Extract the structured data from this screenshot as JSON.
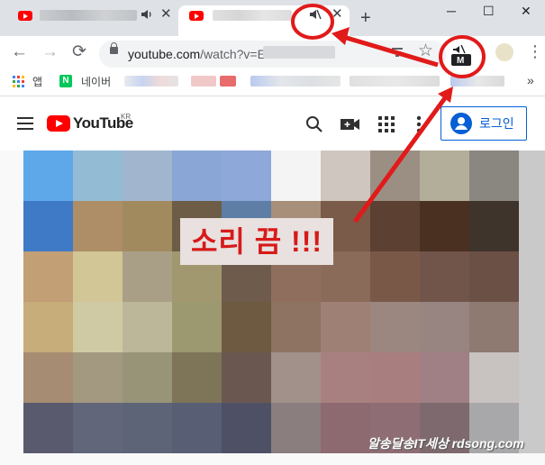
{
  "window": {
    "minimize": "─",
    "maximize": "☐",
    "close": "✕"
  },
  "tabs": [
    {
      "audio_icon": "speaker-icon",
      "close": "✕"
    },
    {
      "audio_icon": "muted-speaker-icon",
      "close": "✕"
    }
  ],
  "new_tab": "+",
  "toolbar": {
    "back": "←",
    "forward": "→",
    "reload": "⟳",
    "url_host": "youtube.com",
    "url_path": "/watch?v=EJi",
    "star": "☆",
    "menu": "⋮",
    "mute_extension_badge": "M"
  },
  "bookmarks": {
    "apps_label": "앱",
    "naver_letter": "N",
    "naver_label": "네이버",
    "more": "»"
  },
  "youtube": {
    "wordmark": "YouTube",
    "region": "KR",
    "login_label": "로그인"
  },
  "annotation": {
    "text": "소리 끔 !!!",
    "color": "#d71a1a"
  },
  "watermark": "알송달송IT세상 rdsong.com",
  "colors": {
    "accent_red": "#ff0000",
    "youtube_blue": "#065fd4",
    "tabstrip": "#dee1e6",
    "mosaic": [
      "#5ea8ea",
      "#93bcd4",
      "#a2b5cf",
      "#8aa6d6",
      "#8fa8da",
      "#f4f4f4",
      "#cfc6bf",
      "#9b8f84",
      "#b3ae9a",
      "#8a8680",
      "#3f7ac6",
      "#ad8e67",
      "#a28a5f",
      "#6d5d46",
      "#5f7ea5",
      "#a88f7a",
      "#7a5a48",
      "#5c4032",
      "#4a3020",
      "#3e342c",
      "#c29f74",
      "#d2c596",
      "#a99f86",
      "#a19870",
      "#6e5b4b",
      "#8f6e5d",
      "#8a6a58",
      "#7a5848",
      "#72554a",
      "#6b5045",
      "#c6ad7a",
      "#cfcaa4",
      "#bcb798",
      "#9c9870",
      "#6e5a40",
      "#8e7262",
      "#9e8074",
      "#9c8780",
      "#988480",
      "#8f7a72",
      "#a58c72",
      "#a39880",
      "#989478",
      "#7e7458",
      "#6a5850",
      "#a2908a",
      "#a88080",
      "#a87e7e",
      "#a08084",
      "#c8c2c0",
      "#5a5a6e",
      "#62667a",
      "#5e6478",
      "#585e74",
      "#4e5066",
      "#8a7e7e",
      "#8c6a70",
      "#8e6e74",
      "#7e6a6e",
      "#a8a8aa"
    ]
  }
}
